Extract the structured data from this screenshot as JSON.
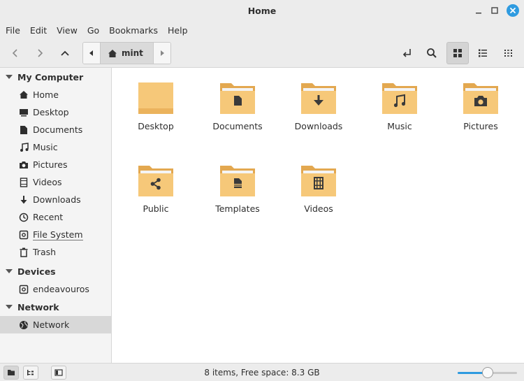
{
  "window": {
    "title": "Home"
  },
  "menu": [
    "File",
    "Edit",
    "View",
    "Go",
    "Bookmarks",
    "Help"
  ],
  "pathbar": {
    "current": "mint"
  },
  "sidebar": {
    "sections": [
      {
        "title": "My Computer"
      },
      {
        "title": "Devices"
      },
      {
        "title": "Network"
      }
    ],
    "items": [
      {
        "label": "Home",
        "icon": "home-icon"
      },
      {
        "label": "Desktop",
        "icon": "desktop-icon"
      },
      {
        "label": "Documents",
        "icon": "document-icon"
      },
      {
        "label": "Music",
        "icon": "music-icon"
      },
      {
        "label": "Pictures",
        "icon": "camera-icon"
      },
      {
        "label": "Videos",
        "icon": "film-icon"
      },
      {
        "label": "Downloads",
        "icon": "download-icon"
      },
      {
        "label": "Recent",
        "icon": "clock-icon"
      },
      {
        "label": "File System",
        "icon": "drive-icon"
      },
      {
        "label": "Trash",
        "icon": "trash-icon"
      },
      {
        "label": "endeavouros",
        "icon": "drive-icon"
      },
      {
        "label": "Network",
        "icon": "globe-icon"
      }
    ]
  },
  "files": [
    {
      "name": "Desktop",
      "icon": "folder-icon"
    },
    {
      "name": "Documents",
      "icon": "folder-documents-icon"
    },
    {
      "name": "Downloads",
      "icon": "folder-downloads-icon"
    },
    {
      "name": "Music",
      "icon": "folder-music-icon"
    },
    {
      "name": "Pictures",
      "icon": "folder-pictures-icon"
    },
    {
      "name": "Public",
      "icon": "folder-public-icon"
    },
    {
      "name": "Templates",
      "icon": "folder-templates-icon"
    },
    {
      "name": "Videos",
      "icon": "folder-videos-icon"
    }
  ],
  "status": {
    "text": "8 items, Free space: 8.3 GB",
    "zoom_level": 0.5
  },
  "colors": {
    "accent": "#2f9be0",
    "folder": "#f6c879",
    "folder_dark": "#e3a850"
  }
}
